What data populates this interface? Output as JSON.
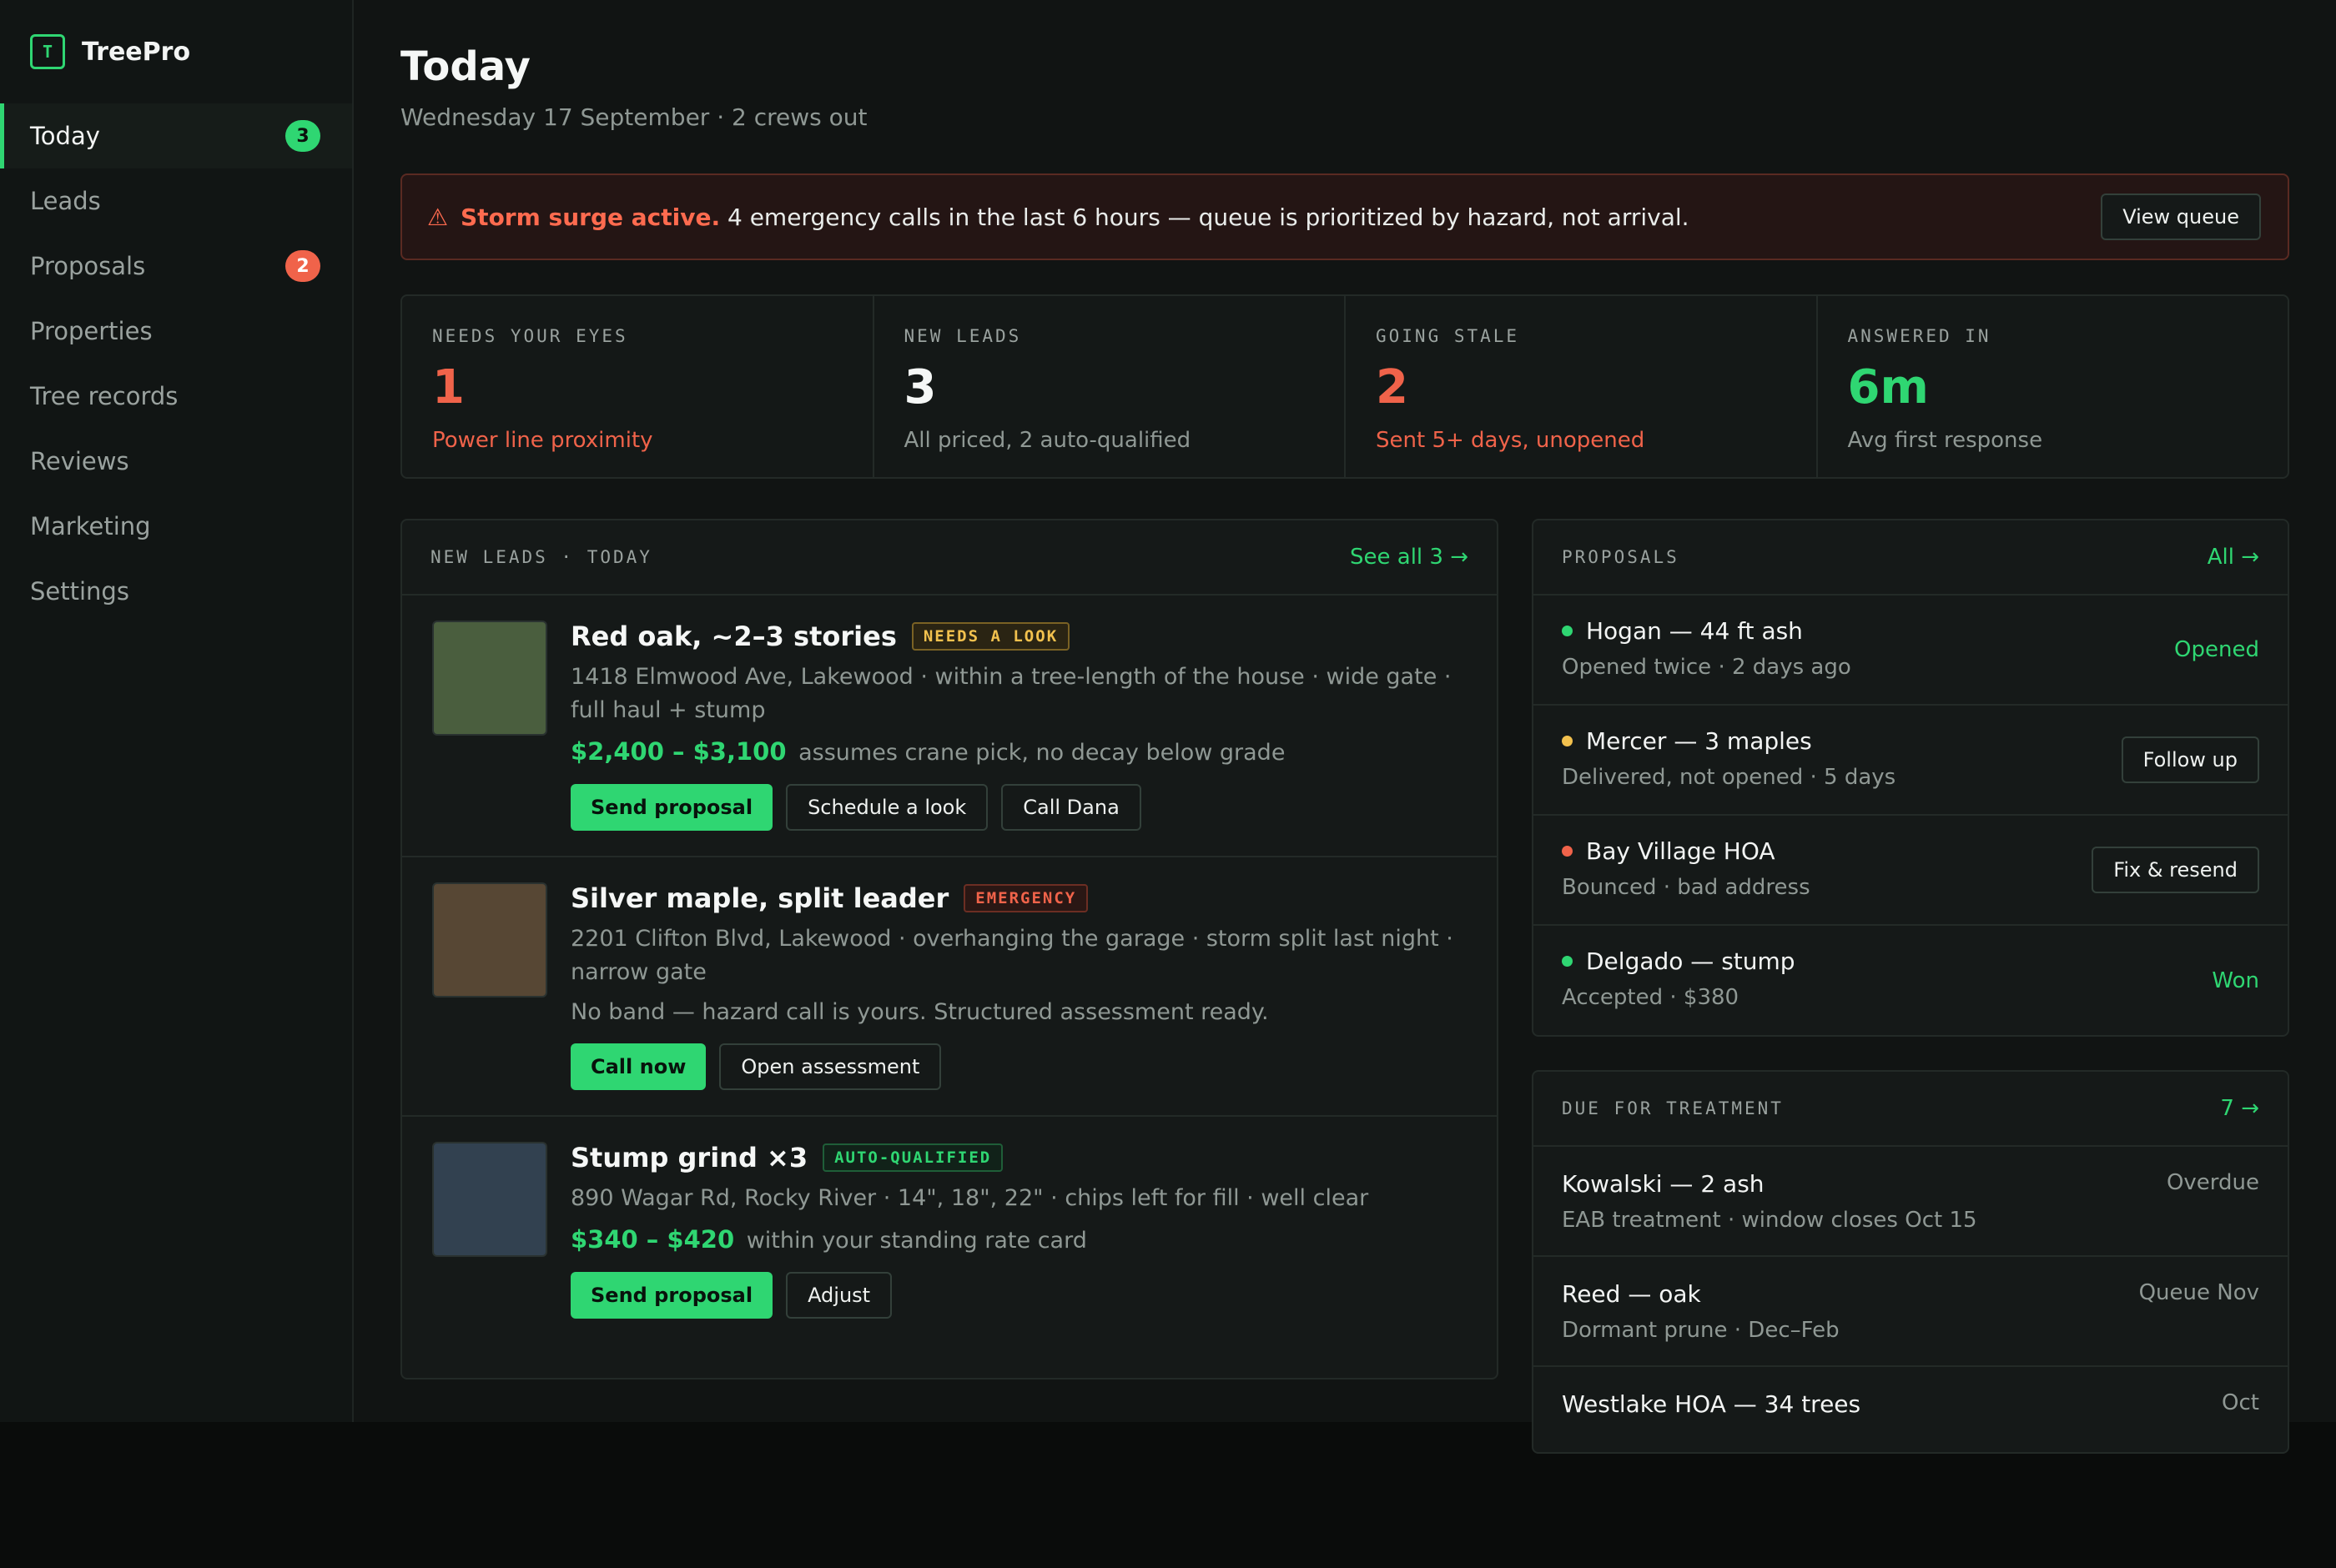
{
  "app": {
    "logo_letter": "T",
    "name": "TreePro"
  },
  "sidebar": {
    "items": [
      {
        "label": "Today",
        "badge": "3",
        "active": true
      },
      {
        "label": "Leads"
      },
      {
        "label": "Proposals",
        "badge": "2"
      },
      {
        "label": "Properties"
      },
      {
        "label": "Tree records"
      },
      {
        "label": "Reviews"
      },
      {
        "label": "Marketing"
      },
      {
        "label": "Settings"
      }
    ]
  },
  "header": {
    "title": "Today",
    "subtitle": "Wednesday 17 September · 2 crews out"
  },
  "alert": {
    "icon": "⚠",
    "strong": "Storm surge active.",
    "text": "4 emergency calls in the last 6 hours — queue is prioritized by hazard, not arrival.",
    "button": "View queue"
  },
  "stats": [
    {
      "label": "NEEDS YOUR EYES",
      "value": "1",
      "note": "Power line proximity"
    },
    {
      "label": "NEW LEADS",
      "value": "3",
      "note": "All priced, 2 auto-qualified"
    },
    {
      "label": "GOING STALE",
      "value": "2",
      "note": "Sent 5+ days, unopened"
    },
    {
      "label": "ANSWERED IN",
      "value": "6m",
      "note": "Avg first response"
    }
  ],
  "leads": {
    "title": "NEW LEADS · TODAY",
    "link": "See all 3 →",
    "items": [
      {
        "title": "Red oak, ~2–3 stories",
        "tag": "NEEDS A LOOK",
        "address": "1418 Elmwood Ave, Lakewood · within a tree-length of the house · wide gate · full haul + stump",
        "price": "$2,400 – $3,100",
        "price_note": "assumes crane pick, no decay below grade",
        "actions": [
          "Send proposal",
          "Schedule a look",
          "Call Dana"
        ],
        "thumb_color": "#4a5e3e"
      },
      {
        "title": "Silver maple, split leader",
        "tag": "EMERGENCY",
        "address": "2201 Clifton Blvd, Lakewood · overhanging the garage · storm split last night · narrow gate",
        "note": "No band — hazard call is yours. Structured assessment ready.",
        "actions": [
          "Call now",
          "Open assessment"
        ],
        "thumb_color": "#574734"
      },
      {
        "title": "Stump grind ×3",
        "tag": "AUTO-QUALIFIED",
        "address": "890 Wagar Rd, Rocky River · 14\", 18\", 22\" · chips left for fill · well clear",
        "price": "$340 – $420",
        "price_note": "within your standing rate card",
        "actions": [
          "Send proposal",
          "Adjust"
        ],
        "thumb_color": "#324150"
      }
    ]
  },
  "proposals": {
    "title": "PROPOSALS",
    "link": "All →",
    "items": [
      {
        "name": "Hogan — 44 ft ash",
        "sub": "Opened twice · 2 days ago",
        "status": "Opened",
        "dot": "#2fd672"
      },
      {
        "name": "Mercer — 3 maples",
        "sub": "Delivered, not opened · 5 days",
        "action": "Follow up",
        "dot": "#f2c14e"
      },
      {
        "name": "Bay Village HOA",
        "sub": "Bounced · bad address",
        "action": "Fix & resend",
        "dot": "#f0634a"
      },
      {
        "name": "Delgado — stump",
        "sub": "Accepted · $380",
        "status": "Won",
        "dot": "#2fd672"
      }
    ]
  },
  "treatment": {
    "title": "DUE FOR TREATMENT",
    "link": "7 →",
    "items": [
      {
        "name": "Kowalski — 2 ash",
        "sub": "EAB treatment · window closes Oct 15",
        "status": "Overdue"
      },
      {
        "name": "Reed — oak",
        "sub": "Dormant prune · Dec–Feb",
        "status": "Queue Nov"
      },
      {
        "name": "Westlake HOA — 34 trees",
        "sub": "",
        "status": "Oct"
      }
    ]
  }
}
